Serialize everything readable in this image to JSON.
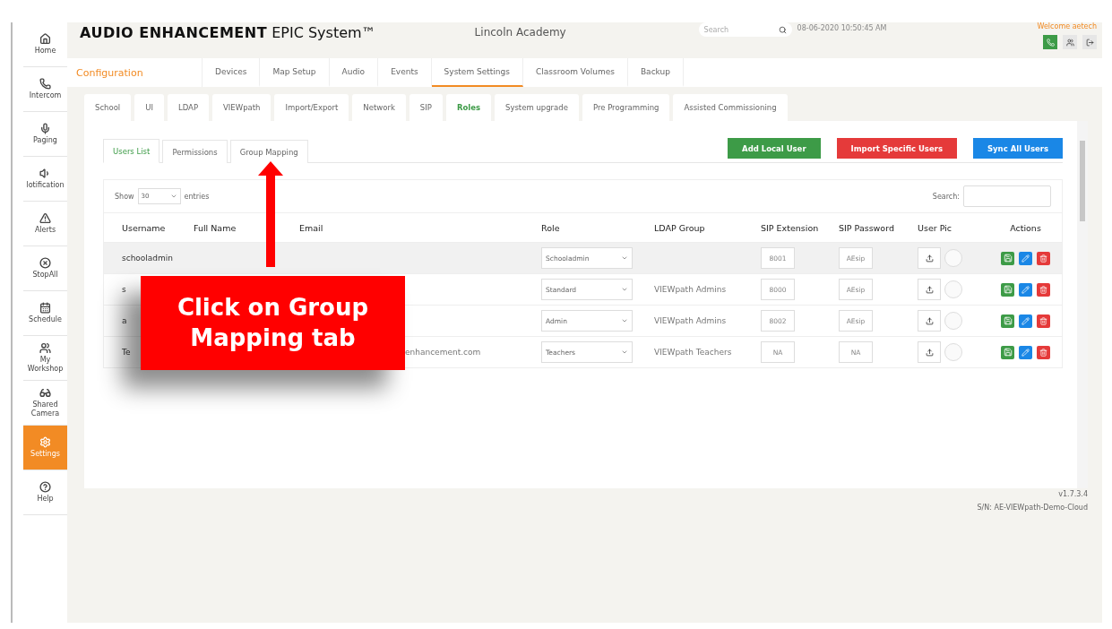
{
  "sidebar": {
    "items": [
      {
        "label": "Home",
        "selected": false
      },
      {
        "label": "Intercom",
        "selected": false
      },
      {
        "label": "Paging",
        "selected": false
      },
      {
        "label": "lotification",
        "selected": false
      },
      {
        "label": "Alerts",
        "selected": false
      },
      {
        "label": "StopAll",
        "selected": false
      },
      {
        "label": "Schedule",
        "selected": false
      },
      {
        "label": "My Workshop",
        "selected": false
      },
      {
        "label": "Shared Camera",
        "selected": false
      },
      {
        "label": "Settings",
        "selected": true
      },
      {
        "label": "Help",
        "selected": false
      }
    ]
  },
  "header": {
    "brand_bold": "AUDIO ENHANCEMENT",
    "brand_rest": "EPIC System™",
    "school": "Lincoln Academy",
    "search": {
      "placeholder": "Search"
    },
    "datetime": "08-06-2020 10:50:45 AM",
    "welcome": "Welcome aetech"
  },
  "nav": {
    "section": "Configuration",
    "tabs": [
      {
        "label": "Devices",
        "selected": false
      },
      {
        "label": "Map Setup",
        "selected": false
      },
      {
        "label": "Audio",
        "selected": false
      },
      {
        "label": "Events",
        "selected": false
      },
      {
        "label": "System Settings",
        "selected": true
      },
      {
        "label": "Classroom Volumes",
        "selected": false
      },
      {
        "label": "Backup",
        "selected": false
      }
    ]
  },
  "subtabs": [
    {
      "label": "School",
      "selected": false
    },
    {
      "label": "UI",
      "selected": false
    },
    {
      "label": "LDAP",
      "selected": false
    },
    {
      "label": "VIEWpath",
      "selected": false
    },
    {
      "label": "Import/Export",
      "selected": false
    },
    {
      "label": "Network",
      "selected": false
    },
    {
      "label": "SIP",
      "selected": false
    },
    {
      "label": "Roles",
      "selected": true
    },
    {
      "label": "System upgrade",
      "selected": false
    },
    {
      "label": "Pre Programming",
      "selected": false
    },
    {
      "label": "Assisted Commissioning",
      "selected": false
    }
  ],
  "panel": {
    "tabs": [
      {
        "label": "Users List",
        "selected": true
      },
      {
        "label": "Permissions",
        "selected": false
      },
      {
        "label": "Group Mapping",
        "selected": false
      }
    ],
    "buttons": [
      {
        "label": "Add Local User",
        "color": "#3d9b47"
      },
      {
        "label": "Import Specific Users",
        "color": "#e53a3a"
      },
      {
        "label": "Sync All Users",
        "color": "#1a87e6"
      }
    ],
    "show_label": "Show",
    "page_size": "30",
    "entries_label": "entries",
    "search_label": "Search:",
    "table": {
      "columns": [
        "Username",
        "Full Name",
        "Email",
        "Role",
        "LDAP Group",
        "SIP Extension",
        "SIP Password",
        "User Pic",
        "Actions"
      ],
      "rows": [
        {
          "username": "schooladmin",
          "full_name": "",
          "email": "",
          "role": "Schooladmin",
          "ldap_group": "",
          "sip_extension": "8001",
          "sip_password": "AEsip",
          "highlighted": true
        },
        {
          "username": "s",
          "full_name": "",
          "email": "",
          "role": "Standard",
          "ldap_group": "VIEWpath Admins",
          "sip_extension": "8000",
          "sip_password": "AEsip",
          "highlighted": false
        },
        {
          "username": "a",
          "full_name": "",
          "email": "",
          "role": "Admin",
          "ldap_group": "VIEWpath Admins",
          "sip_extension": "8002",
          "sip_password": "AEsip",
          "highlighted": false
        },
        {
          "username": "Te",
          "full_name": "",
          "email": "enhancement.com",
          "role": "Teachers",
          "ldap_group": "VIEWpath Teachers",
          "sip_extension": "NA",
          "sip_password": "NA",
          "highlighted": false
        }
      ]
    }
  },
  "footer": {
    "version": "v1.7.3.4",
    "serial": "S/N: AE-VIEWpath-Demo-Cloud"
  },
  "callout": {
    "text": "Click on Group Mapping tab"
  }
}
